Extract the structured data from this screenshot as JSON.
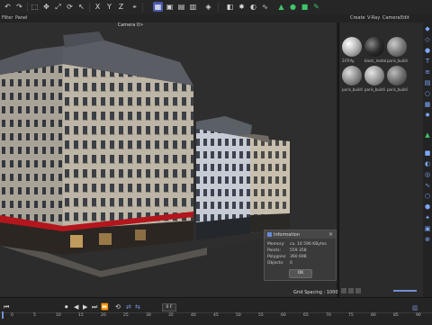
{
  "menubar": {
    "filter": "Filter",
    "panel": "Panel"
  },
  "panel_menu": {
    "create": "Create",
    "vray": "V-Ray",
    "camera": "Camera",
    "edit": "Edit"
  },
  "viewport": {
    "camera_label": "Camera 0>",
    "grid_spacing": "Grid Spacing : 10000 cm"
  },
  "materials": [
    {
      "label": "2XTrAy",
      "color": "#b8b8b8"
    },
    {
      "label": "black_metal",
      "color": "#2a2a2a"
    },
    {
      "label": "paris_buildi",
      "color": "#7a7a7a"
    },
    {
      "label": "paris_buildi",
      "color": "#8c8c8c"
    },
    {
      "label": "paris_buildi",
      "color": "#9a9a9a"
    },
    {
      "label": "paris_buildi",
      "color": "#6e6e6e"
    }
  ],
  "info_dialog": {
    "title": "Information",
    "rows": [
      {
        "label": "Memory:",
        "value": "ca. 16 596 KBytes"
      },
      {
        "label": "Points:",
        "value": "559 358"
      },
      {
        "label": "Polygons:",
        "value": "360 698"
      },
      {
        "label": "Objects:",
        "value": "0"
      }
    ],
    "ok_label": "OK"
  },
  "timeline": {
    "frame_field": "0 F",
    "ticks": [
      "0",
      "5",
      "10",
      "15",
      "20",
      "25",
      "30",
      "35",
      "40",
      "45",
      "50",
      "55",
      "60",
      "65",
      "70",
      "75",
      "80",
      "85",
      "90"
    ]
  },
  "colors": {
    "accent": "#4a5aa8",
    "green": "#3ec56a",
    "awning_red": "#b3161c"
  },
  "icons": [
    "undo-icon",
    "redo-icon",
    "move-icon",
    "scale-icon",
    "rotate-icon",
    "x-axis-icon",
    "y-axis-icon",
    "z-axis-icon",
    "render-icon",
    "cube-icon",
    "pen-icon"
  ]
}
